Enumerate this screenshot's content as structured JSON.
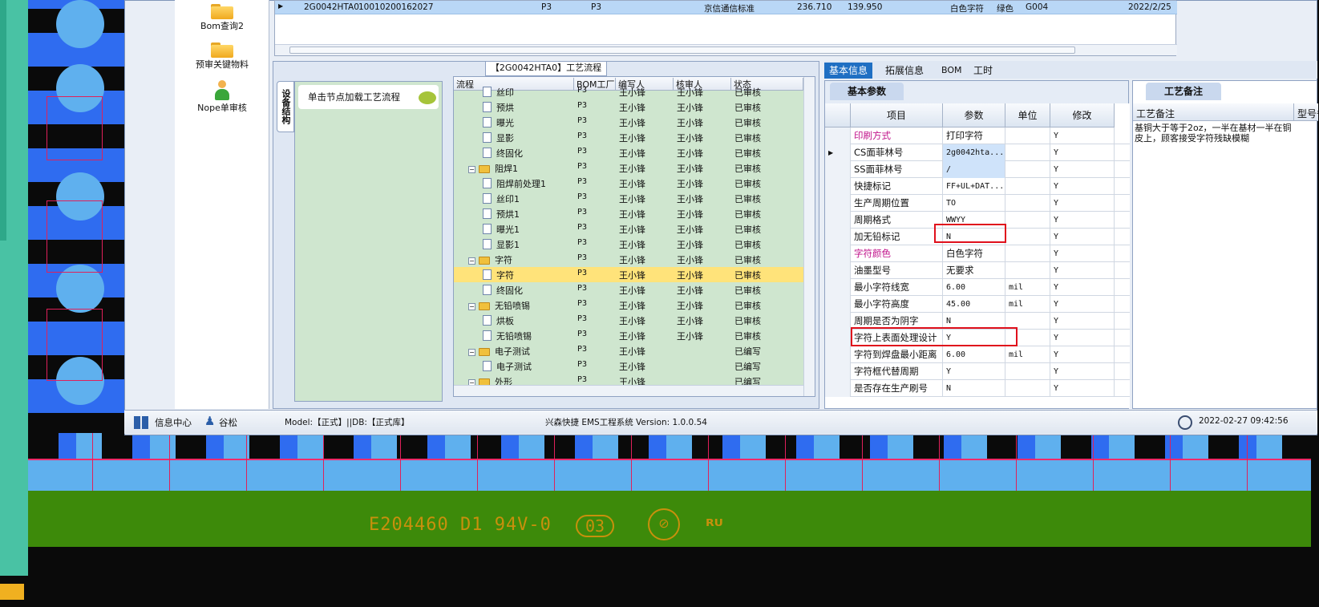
{
  "top_table": {
    "row": [
      "2G0042HTA0",
      "10010200162027",
      "P3",
      "P3",
      "京信通信标准",
      "236.710",
      "139.950",
      "白色字符",
      "绿色",
      "G004",
      "2022/2/25"
    ]
  },
  "left_nav": [
    {
      "label": "Bom查询2",
      "icon": "folder-icon"
    },
    {
      "label": "预审关键物料",
      "icon": "folder-icon"
    },
    {
      "label": "Nope单审核",
      "icon": "person-icon"
    }
  ],
  "flow": {
    "title": "【2G0042HTA0】工艺流程",
    "vtab": "设备结构",
    "node_hint": "单击节点加载工艺流程",
    "columns": [
      "流程",
      "BOM工厂",
      "编写人",
      "核审人",
      "状态"
    ],
    "rows": [
      {
        "indent": 2,
        "folder": false,
        "name": "丝印",
        "factory": "P3",
        "writer": "王小锋",
        "reviewer": "王小锋",
        "status": "已审核"
      },
      {
        "indent": 2,
        "folder": false,
        "name": "预烘",
        "factory": "P3",
        "writer": "王小锋",
        "reviewer": "王小锋",
        "status": "已审核"
      },
      {
        "indent": 2,
        "folder": false,
        "name": "曝光",
        "factory": "P3",
        "writer": "王小锋",
        "reviewer": "王小锋",
        "status": "已审核"
      },
      {
        "indent": 2,
        "folder": false,
        "name": "显影",
        "factory": "P3",
        "writer": "王小锋",
        "reviewer": "王小锋",
        "status": "已审核"
      },
      {
        "indent": 2,
        "folder": false,
        "name": "终固化",
        "factory": "P3",
        "writer": "王小锋",
        "reviewer": "王小锋",
        "status": "已审核"
      },
      {
        "indent": 1,
        "folder": true,
        "name": "阻焊1",
        "factory": "P3",
        "writer": "王小锋",
        "reviewer": "王小锋",
        "status": "已审核"
      },
      {
        "indent": 2,
        "folder": false,
        "name": "阻焊前处理1",
        "factory": "P3",
        "writer": "王小锋",
        "reviewer": "王小锋",
        "status": "已审核"
      },
      {
        "indent": 2,
        "folder": false,
        "name": "丝印1",
        "factory": "P3",
        "writer": "王小锋",
        "reviewer": "王小锋",
        "status": "已审核"
      },
      {
        "indent": 2,
        "folder": false,
        "name": "预烘1",
        "factory": "P3",
        "writer": "王小锋",
        "reviewer": "王小锋",
        "status": "已审核"
      },
      {
        "indent": 2,
        "folder": false,
        "name": "曝光1",
        "factory": "P3",
        "writer": "王小锋",
        "reviewer": "王小锋",
        "status": "已审核"
      },
      {
        "indent": 2,
        "folder": false,
        "name": "显影1",
        "factory": "P3",
        "writer": "王小锋",
        "reviewer": "王小锋",
        "status": "已审核"
      },
      {
        "indent": 1,
        "folder": true,
        "name": "字符",
        "factory": "P3",
        "writer": "王小锋",
        "reviewer": "王小锋",
        "status": "已审核"
      },
      {
        "indent": 2,
        "folder": false,
        "name": "字符",
        "factory": "P3",
        "writer": "王小锋",
        "reviewer": "王小锋",
        "status": "已审核",
        "selected": true
      },
      {
        "indent": 2,
        "folder": false,
        "name": "终固化",
        "factory": "P3",
        "writer": "王小锋",
        "reviewer": "王小锋",
        "status": "已审核"
      },
      {
        "indent": 1,
        "folder": true,
        "name": "无铅喷锡",
        "factory": "P3",
        "writer": "王小锋",
        "reviewer": "王小锋",
        "status": "已审核"
      },
      {
        "indent": 2,
        "folder": false,
        "name": "烘板",
        "factory": "P3",
        "writer": "王小锋",
        "reviewer": "王小锋",
        "status": "已审核"
      },
      {
        "indent": 2,
        "folder": false,
        "name": "无铅喷锡",
        "factory": "P3",
        "writer": "王小锋",
        "reviewer": "王小锋",
        "status": "已审核"
      },
      {
        "indent": 1,
        "folder": true,
        "name": "电子测试",
        "factory": "P3",
        "writer": "王小锋",
        "reviewer": "",
        "status": "已编写"
      },
      {
        "indent": 2,
        "folder": false,
        "name": "电子测试",
        "factory": "P3",
        "writer": "王小锋",
        "reviewer": "",
        "status": "已编写"
      },
      {
        "indent": 1,
        "folder": true,
        "name": "外形",
        "factory": "P3",
        "writer": "王小锋",
        "reviewer": "",
        "status": "已编写"
      }
    ]
  },
  "right_tabs": [
    "基本信息",
    "拓展信息",
    "BOM",
    "工时"
  ],
  "basic": {
    "title": "基本参数",
    "columns": [
      "项目",
      "参数",
      "单位",
      "修改"
    ],
    "rows": [
      {
        "item": "印刷方式",
        "value": "打印字符",
        "unit": "",
        "mod": "Y",
        "mag": true
      },
      {
        "item": "CS面菲林号",
        "value": "2g0042hta...",
        "unit": "",
        "mod": "Y",
        "cur": true,
        "hl": true
      },
      {
        "item": "SS面菲林号",
        "value": "/",
        "unit": "",
        "mod": "Y",
        "hl": true
      },
      {
        "item": "快捷标记",
        "value": "FF+UL+DAT...",
        "unit": "",
        "mod": "Y"
      },
      {
        "item": "生产周期位置",
        "value": "TO",
        "unit": "",
        "mod": "Y"
      },
      {
        "item": "周期格式",
        "value": "WWYY",
        "unit": "",
        "mod": "Y"
      },
      {
        "item": "加无铅标记",
        "value": "N",
        "unit": "",
        "mod": "Y"
      },
      {
        "item": "字符颜色",
        "value": "白色字符",
        "unit": "",
        "mod": "Y",
        "mag": true
      },
      {
        "item": "油墨型号",
        "value": "无要求",
        "unit": "",
        "mod": "Y"
      },
      {
        "item": "最小字符线宽",
        "value": "6.00",
        "unit": "mil",
        "mod": "Y"
      },
      {
        "item": "最小字符高度",
        "value": "45.00",
        "unit": "mil",
        "mod": "Y"
      },
      {
        "item": "周期是否为阴字",
        "value": "N",
        "unit": "",
        "mod": "Y"
      },
      {
        "item": "字符上表面处理设计",
        "value": "Y",
        "unit": "",
        "mod": "Y"
      },
      {
        "item": "字符到焊盘最小距离",
        "value": "6.00",
        "unit": "mil",
        "mod": "Y"
      },
      {
        "item": "字符框代替周期",
        "value": "Y",
        "unit": "",
        "mod": "Y"
      },
      {
        "item": "是否存在生产刷号",
        "value": "N",
        "unit": "",
        "mod": "Y"
      }
    ]
  },
  "notes": {
    "title": "工艺备注",
    "col1": "工艺备注",
    "col2": "型号备",
    "text": "基铜大于等于2oz，一半在基材一半在铜皮上，顾客接受字符残缺模糊"
  },
  "status": {
    "info": "信息中心",
    "user": "谷松",
    "model": "Model:【正式】||DB:【正式库】",
    "app": "兴森快捷 EMS工程系统 Version: 1.0.0.54",
    "time": "2022-02-27 09:42:56"
  },
  "pcb": {
    "marking": "E204460 D1 94V-0",
    "date_code": "03"
  }
}
